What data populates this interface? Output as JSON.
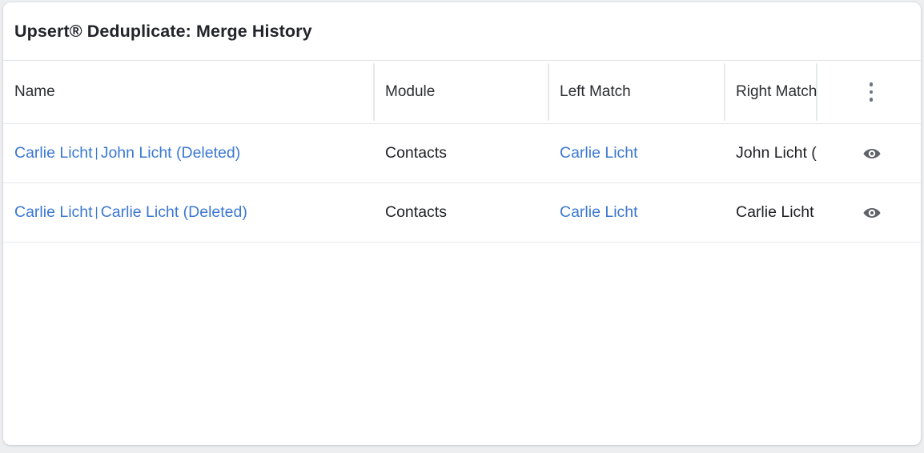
{
  "card": {
    "title": "Upsert® Deduplicate: Merge History"
  },
  "table": {
    "columns": [
      {
        "key": "name",
        "label": "Name"
      },
      {
        "key": "module",
        "label": "Module"
      },
      {
        "key": "left",
        "label": "Left Match"
      },
      {
        "key": "right",
        "label": "Right Match",
        "clipped_label": "Right Mat"
      },
      {
        "key": "action",
        "label": "",
        "menu_icon": "kebab-menu-icon"
      }
    ],
    "rows": [
      {
        "name_left": "Carlie Licht",
        "name_separator": "|",
        "name_right": "John Licht (Deleted)",
        "module": "Contacts",
        "left_match": "Carlie Licht",
        "right_match": "John Licht (Deleted)",
        "right_match_clipped": "John Lic",
        "action_icon": "eye-icon"
      },
      {
        "name_left": "Carlie Licht",
        "name_separator": "|",
        "name_right": "Carlie Licht (Deleted)",
        "module": "Contacts",
        "left_match": "Carlie Licht",
        "right_match": "Carlie Licht (Deleted)",
        "right_match_clipped": "Carlie L",
        "action_icon": "eye-icon"
      }
    ]
  },
  "colors": {
    "link": "#3b78d0",
    "text": "#1f2024",
    "header_text": "#2b2d31",
    "divider": "#e6e9ec",
    "row_divider": "#e8eaed",
    "icon": "#5f6368",
    "page_background": "#eceef0",
    "card_background": "#ffffff"
  }
}
